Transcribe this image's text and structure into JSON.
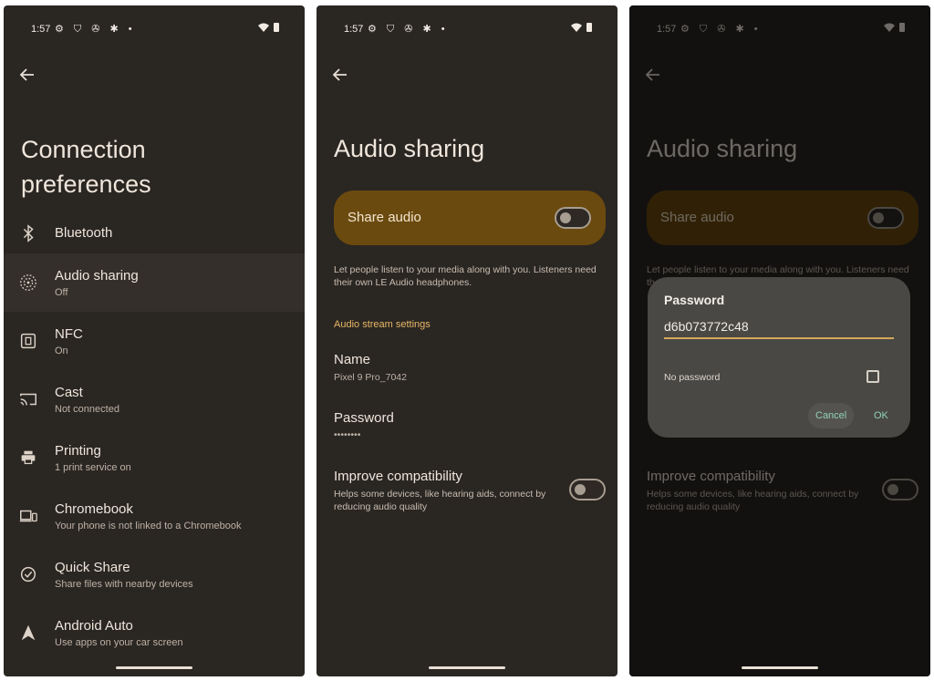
{
  "status": {
    "time": "1:57",
    "icons": "⚙ ⛉ ✇ ✱ •"
  },
  "screen1": {
    "title_line1": "Connection",
    "title_line2": "preferences",
    "items": [
      {
        "title": "Bluetooth",
        "subtitle": "",
        "icon": "bluetooth-icon"
      },
      {
        "title": "Audio sharing",
        "subtitle": "Off",
        "icon": "audio-sharing-icon"
      },
      {
        "title": "NFC",
        "subtitle": "On",
        "icon": "nfc-icon"
      },
      {
        "title": "Cast",
        "subtitle": "Not connected",
        "icon": "cast-icon"
      },
      {
        "title": "Printing",
        "subtitle": "1 print service on",
        "icon": "printer-icon"
      },
      {
        "title": "Chromebook",
        "subtitle": "Your phone is not linked to a Chromebook",
        "icon": "chromebook-icon"
      },
      {
        "title": "Quick Share",
        "subtitle": "Share files with nearby devices",
        "icon": "quick-share-icon"
      },
      {
        "title": "Android Auto",
        "subtitle": "Use apps on your car screen",
        "icon": "android-auto-icon"
      }
    ]
  },
  "screen2": {
    "title": "Audio sharing",
    "share_label": "Share audio",
    "share_on": false,
    "description": "Let people listen to your media along with you. Listeners need their own LE Audio headphones.",
    "section": "Audio stream settings",
    "name_label": "Name",
    "name_value": "Pixel 9 Pro_7042",
    "password_label": "Password",
    "password_value": "••••••••",
    "compat_label": "Improve compatibility",
    "compat_desc": "Helps some devices, like hearing aids, connect by reducing audio quality",
    "compat_on": false
  },
  "dialog": {
    "title": "Password",
    "value": "d6b073772c48",
    "no_password_label": "No password",
    "no_password_checked": false,
    "cancel_label": "Cancel",
    "ok_label": "OK"
  },
  "colors": {
    "background": "#2a2622",
    "share_card": "#6b4a0f",
    "accent_text": "#e8b866",
    "dialog_button": "#8fd1b9"
  }
}
